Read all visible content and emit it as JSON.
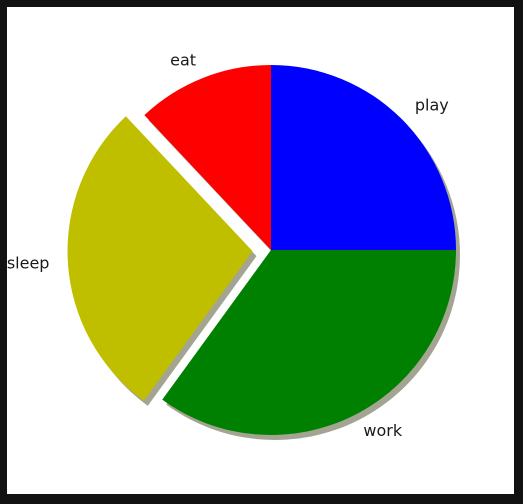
{
  "chart_data": {
    "type": "pie",
    "title": "",
    "categories": [
      "play",
      "work",
      "sleep",
      "eat"
    ],
    "values": [
      25,
      35,
      28,
      12
    ],
    "colors": [
      "#0000ff",
      "#008000",
      "#bfbf00",
      "#ff0000"
    ],
    "explode": [
      0,
      0,
      0.1,
      0
    ],
    "shadow": true,
    "start_angle_deg": 90,
    "direction": "clockwise",
    "legend": "none"
  }
}
